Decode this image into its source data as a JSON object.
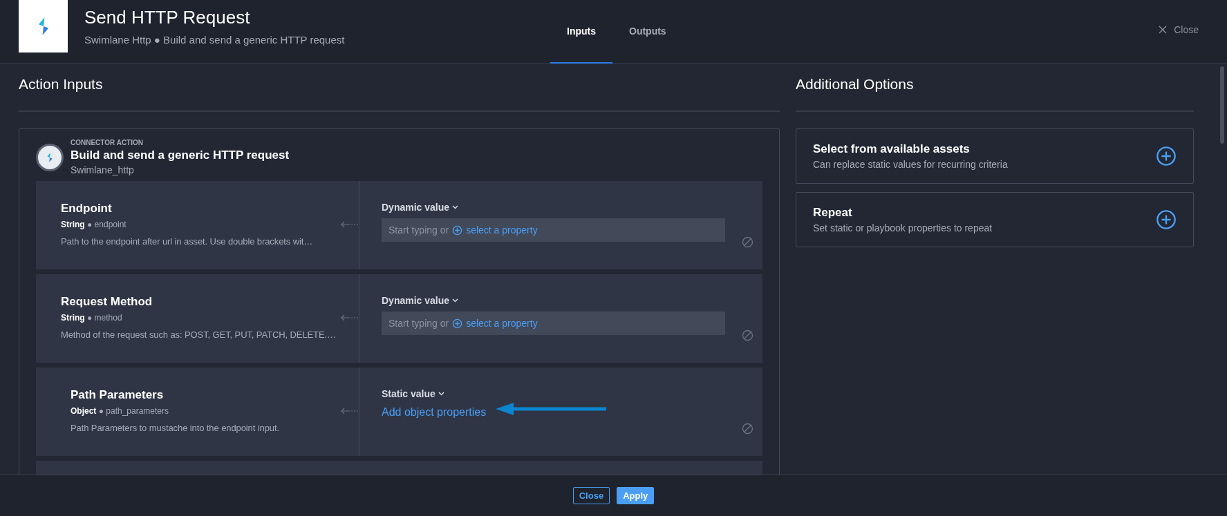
{
  "header": {
    "title": "Send HTTP Request",
    "subtitle": "Swimlane Http ● Build and send a generic HTTP request",
    "tabs": [
      {
        "label": "Inputs",
        "selected": true
      },
      {
        "label": "Outputs",
        "selected": false
      }
    ],
    "close": "Close"
  },
  "action_inputs": {
    "title": "Action Inputs",
    "card": {
      "eyebrow": "CONNECTOR ACTION",
      "title": "Build and send a generic HTTP request",
      "subtitle": "Swimlane_http",
      "rows": [
        {
          "kind": "dynamic",
          "label": "Endpoint",
          "type": "String",
          "separator": "●",
          "key": "endpoint",
          "description": "Path to the endpoint after url in asset. Use double brackets wit…",
          "mode": "Dynamic value",
          "placeholder": "Start typing or",
          "link": "select a property"
        },
        {
          "kind": "dynamic",
          "label": "Request Method",
          "type": "String",
          "separator": "●",
          "key": "method",
          "description": "Method of the request such as: POST, GET, PUT, PATCH, DELETE.…",
          "mode": "Dynamic value",
          "placeholder": "Start typing or",
          "link": "select a property"
        },
        {
          "kind": "static",
          "label": "Path Parameters",
          "type": "Object",
          "separator": "●",
          "key": "path_parameters",
          "description": "Path Parameters to mustache into the endpoint input.",
          "mode": "Static value",
          "link": "Add object properties"
        },
        {
          "kind": "empty"
        }
      ]
    }
  },
  "additional_options": {
    "title": "Additional Options",
    "items": [
      {
        "title": "Select from available assets",
        "description": "Can replace static values for recurring criteria"
      },
      {
        "title": "Repeat",
        "description": "Set static or playbook properties to repeat"
      }
    ]
  },
  "footer": {
    "buttons": [
      {
        "label": "Close",
        "kind": "outline"
      },
      {
        "label": "Apply",
        "kind": "primary"
      }
    ]
  }
}
